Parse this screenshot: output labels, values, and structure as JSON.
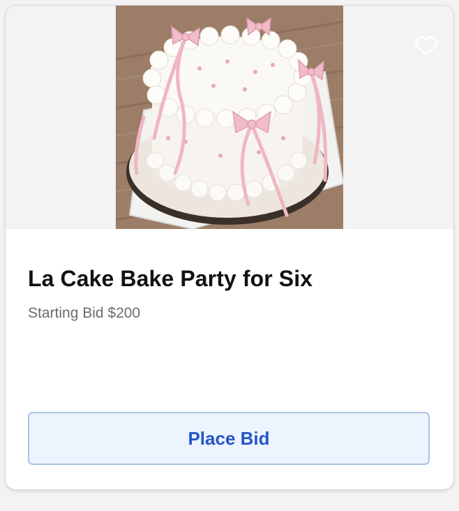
{
  "item": {
    "title": "La Cake Bake Party for Six",
    "starting_bid": "Starting Bid $200"
  },
  "actions": {
    "place_bid_label": "Place Bid",
    "favorite_icon": "heart-icon"
  },
  "colors": {
    "accent": "#2456c7",
    "button_background": "#eef4fd",
    "button_border": "#a9c4ea",
    "title_text": "#111111",
    "subtitle_text": "#6b6b72"
  }
}
